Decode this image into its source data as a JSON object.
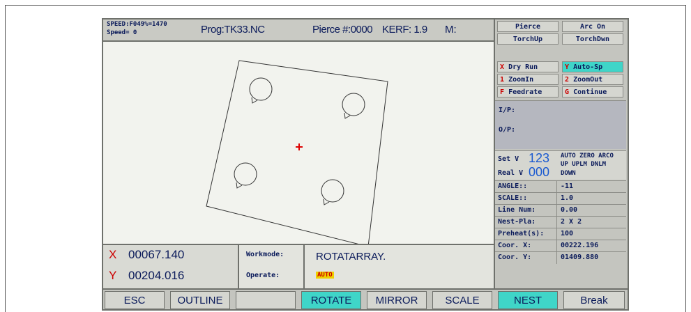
{
  "status": {
    "speed_line1": "SPEED:F049%=1470",
    "speed_line2": "Speed=  0",
    "program": "Prog:TK33.NC",
    "pierce": "Pierce #:0000",
    "kerf": "KERF: 1.9",
    "m_label": "M:"
  },
  "coords": {
    "x_label": "X",
    "x_value": "00067.140",
    "y_label": "Y",
    "y_value": "00204.016"
  },
  "mode": {
    "workmode_label": "Workmode:",
    "workmode_value": "ROTATARRAY.",
    "operate_label": "Operate:",
    "operate_value": "AUTO"
  },
  "right_panel": {
    "pierce": "Pierce",
    "arc_on": "Arc On",
    "torch_up": "TorchUp",
    "torch_down": "TorchDwn",
    "dry_run_key": "X",
    "dry_run": "Dry Run",
    "auto_sp_key": "Y",
    "auto_sp": "Auto-Sp",
    "zoom_in_key": "1",
    "zoom_in": "ZoomIn",
    "zoom_out_key": "2",
    "zoom_out": "ZoomOut",
    "feedrate_key": "F",
    "feedrate": "Feedrate",
    "continue_key": "G",
    "continue": "Continue",
    "ip": "I/P:",
    "op": "O/P:",
    "set_label": "Set  V",
    "set_value": "123",
    "real_label": "Real V",
    "real_value": "000",
    "flags_line1": "AUTO ZERO ARCO",
    "flags_line2": "UP   UPLM DNLM",
    "flags_line3": "DOWN"
  },
  "params": [
    {
      "label": "ANGLE::",
      "value": "-11"
    },
    {
      "label": "SCALE::",
      "value": "1.0"
    },
    {
      "label": "Line Num:",
      "value": "0.00"
    },
    {
      "label": "Nest-Pla:",
      "value": "2 X 2"
    },
    {
      "label": "Preheat(s):",
      "value": "100"
    },
    {
      "label": "Coor. X:",
      "value": "00222.196"
    },
    {
      "label": "Coor. Y:",
      "value": "01409.880"
    }
  ],
  "fkeys": {
    "esc": "ESC",
    "outline": "OUTLINE",
    "blank": "",
    "rotate": "ROTATE",
    "mirror": "MIRROR",
    "scale": "SCALE",
    "nest": "NEST",
    "break": "Break"
  },
  "colors": {
    "active_key": "#3fd5c8",
    "axis_label": "#cc0000",
    "text": "#0a1a5a"
  }
}
